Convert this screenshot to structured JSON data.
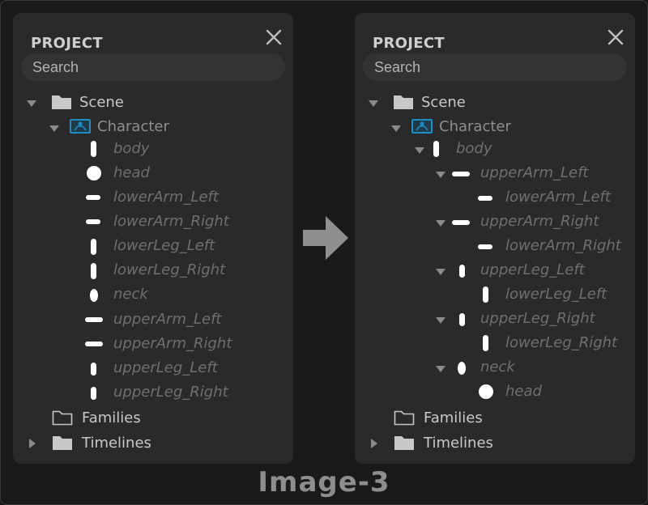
{
  "caption": "Image-3",
  "colors": {
    "accent": "#1e8ec4",
    "arrow": "#8a8a8a",
    "shape": "#ffffff"
  },
  "left_panel": {
    "title": "PROJECT",
    "search_placeholder": "Search",
    "tree": {
      "scene_label": "Scene",
      "character_label": "Character",
      "bones": [
        "body",
        "head",
        "lowerArm_Left",
        "lowerArm_Right",
        "lowerLeg_Left",
        "lowerLeg_Right",
        "neck",
        "upperArm_Left",
        "upperArm_Right",
        "upperLeg_Left",
        "upperLeg_Right"
      ],
      "families_label": "Families",
      "timelines_label": "Timelines"
    }
  },
  "right_panel": {
    "title": "PROJECT",
    "search_placeholder": "Search",
    "tree": {
      "scene_label": "Scene",
      "character_label": "Character",
      "body_label": "body",
      "upper_arm_left": "upperArm_Left",
      "lower_arm_left": "lowerArm_Left",
      "upper_arm_right": "upperArm_Right",
      "lower_arm_right": "lowerArm_Right",
      "upper_leg_left": "upperLeg_Left",
      "lower_leg_left": "lowerLeg_Left",
      "upper_leg_right": "upperLeg_Right",
      "lower_leg_right": "lowerLeg_Right",
      "neck_label": "neck",
      "head_label": "head",
      "families_label": "Families",
      "timelines_label": "Timelines"
    }
  }
}
